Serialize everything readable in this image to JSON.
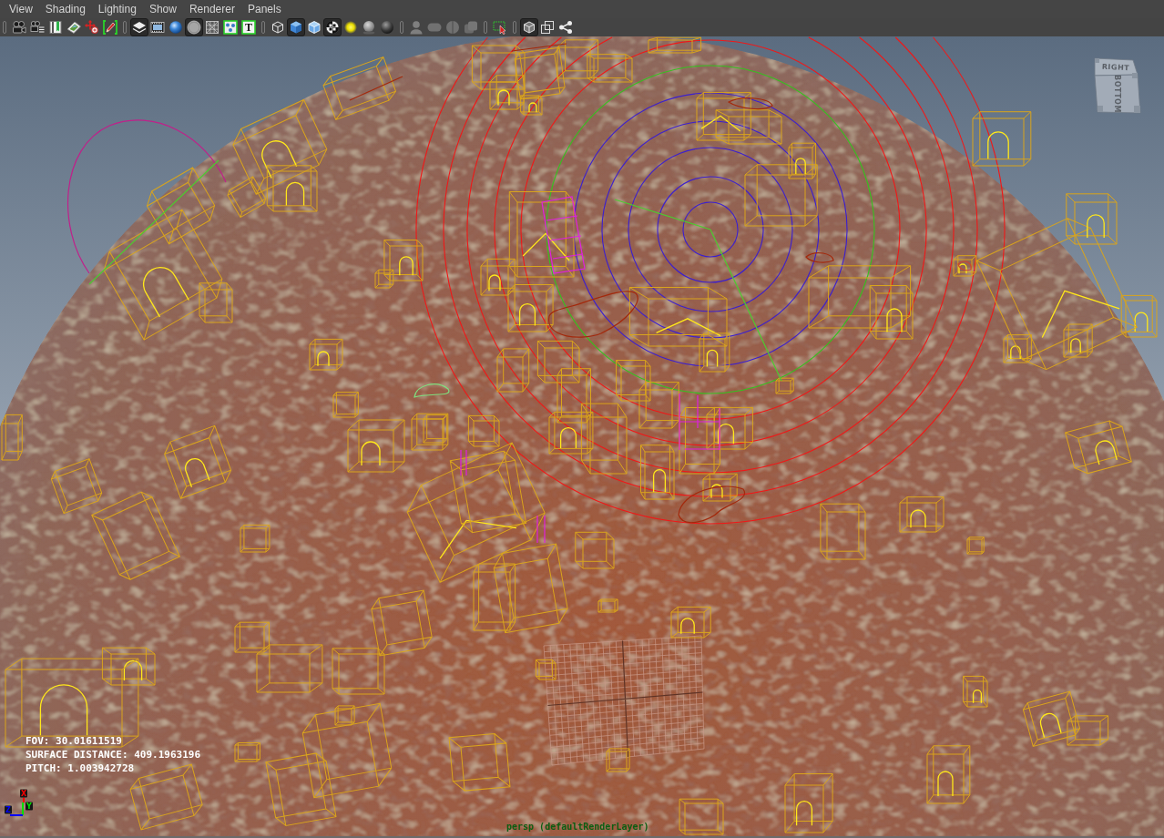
{
  "menu": [
    {
      "label": "View"
    },
    {
      "label": "Shading"
    },
    {
      "label": "Lighting"
    },
    {
      "label": "Show"
    },
    {
      "label": "Renderer"
    },
    {
      "label": "Panels"
    }
  ],
  "toolbar": [
    [
      {
        "on": false,
        "disabled": false
      },
      {
        "on": false,
        "disabled": false
      },
      {
        "on": false,
        "disabled": false
      },
      {
        "on": false,
        "disabled": false
      },
      {
        "on": false,
        "disabled": false
      },
      {
        "on": false,
        "disabled": false
      }
    ],
    [
      {
        "on": true,
        "disabled": false
      },
      {
        "on": false,
        "disabled": false
      },
      {
        "on": false,
        "disabled": false
      },
      {
        "on": true,
        "disabled": false
      },
      {
        "on": false,
        "disabled": false
      },
      {
        "on": false,
        "disabled": false
      },
      {
        "on": false,
        "disabled": false,
        "glyph": "T"
      }
    ],
    [
      {
        "on": false,
        "disabled": false
      },
      {
        "on": true,
        "disabled": false
      },
      {
        "on": false,
        "disabled": false
      },
      {
        "on": true,
        "disabled": false
      },
      {
        "on": false,
        "disabled": false
      },
      {
        "on": false,
        "disabled": false
      },
      {
        "on": false,
        "disabled": false
      }
    ],
    [
      {
        "on": false,
        "disabled": true
      },
      {
        "on": false,
        "disabled": true
      },
      {
        "on": false,
        "disabled": true
      },
      {
        "on": false,
        "disabled": true
      }
    ],
    [
      {
        "on": false,
        "disabled": false
      }
    ],
    [
      {
        "on": true,
        "disabled": false
      },
      {
        "on": false,
        "disabled": false
      },
      {
        "on": false,
        "disabled": false
      }
    ]
  ],
  "viewport": {
    "view_cube": {
      "top_face": "RIGHT",
      "front_face": "BOTTOM"
    },
    "hud_lines": [
      "FOV: 30.01611519",
      "SURFACE DISTANCE: 409.1963196",
      "PITCH: 1.003942728"
    ],
    "axes": [
      {
        "label": "X",
        "color": "#ff0000"
      },
      {
        "label": "Y",
        "color": "#00e000"
      },
      {
        "label": "Z",
        "color": "#0000ff"
      }
    ],
    "camera_label": "persp (defaultRenderLayer)"
  }
}
